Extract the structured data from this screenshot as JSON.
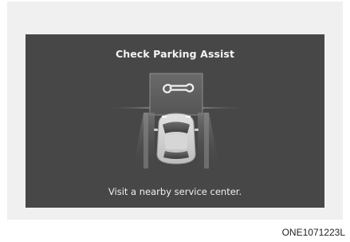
{
  "screen": {
    "title": "Check Parking Assist",
    "message": "Visit a nearby service center."
  },
  "icons": {
    "warning": "wrench-icon",
    "vehicle": "car-top-view-icon"
  },
  "figure": {
    "code": "ONE1071223L"
  },
  "colors": {
    "screen_background": "#474747",
    "panel_background": "#f0f0f0",
    "text": "#f4f4f4"
  }
}
